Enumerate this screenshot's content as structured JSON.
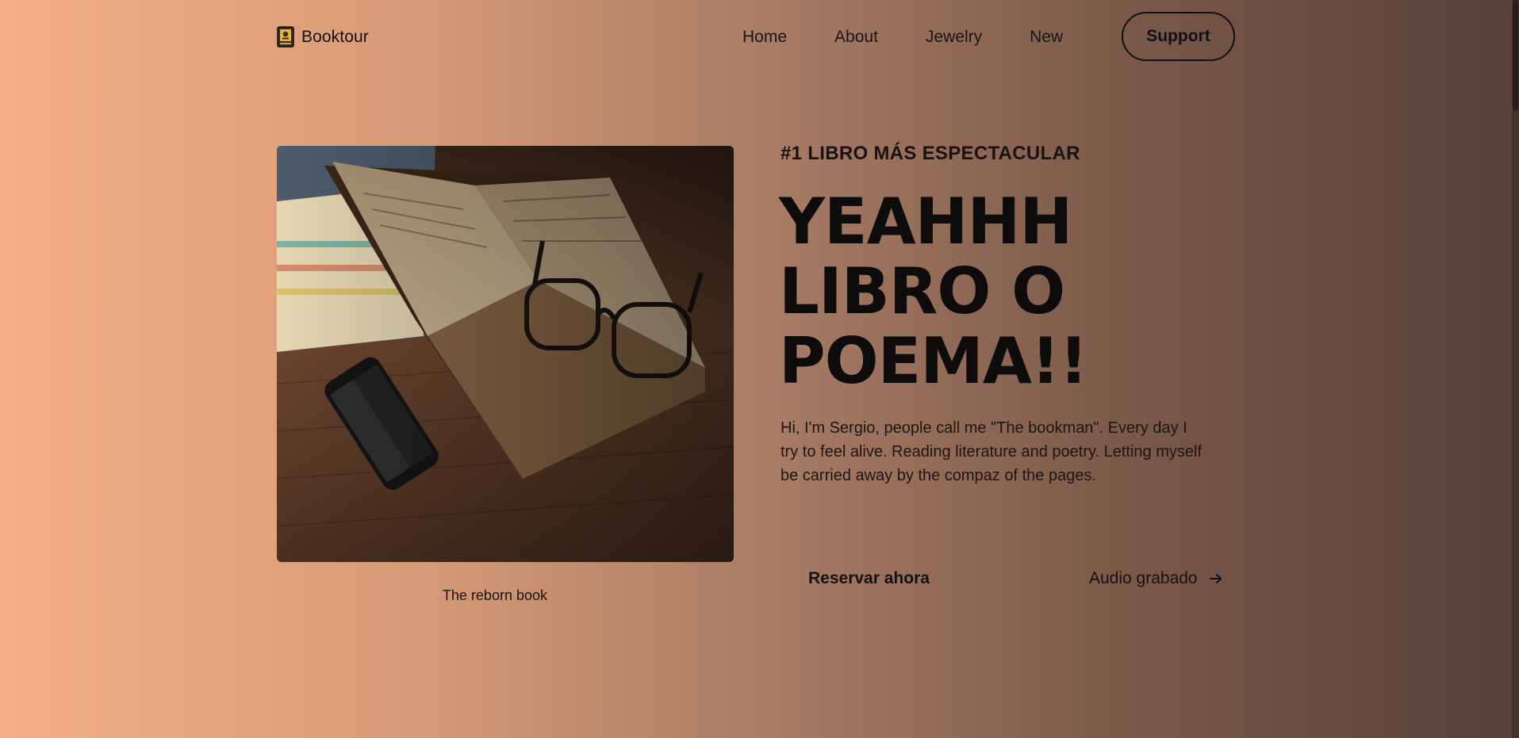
{
  "brand": {
    "name": "Booktour",
    "icon": "book-icon"
  },
  "nav": {
    "links": [
      "Home",
      "About",
      "Jewelry",
      "New"
    ],
    "support_label": "Support"
  },
  "hero": {
    "image_icon": "book-glasses-phone-photo",
    "caption": "The reborn book",
    "eyebrow": "#1 LIBRO MÁS ESPECTACULAR",
    "headline_lines": [
      "YEAHHH",
      "LIBRO O",
      "POEMA!!"
    ],
    "intro": "Hi, I'm Sergio, people call me \"The bookman\". Every day I try to feel alive. Reading literature and poetry. Letting myself be carried away by the compaz of the pages.",
    "primary_cta": "Reservar ahora",
    "secondary_cta": "Audio grabado",
    "secondary_cta_icon": "arrow-right-icon"
  },
  "colors": {
    "gradient_start": "#f4b086",
    "gradient_end": "#56403a",
    "text": "#111111"
  }
}
